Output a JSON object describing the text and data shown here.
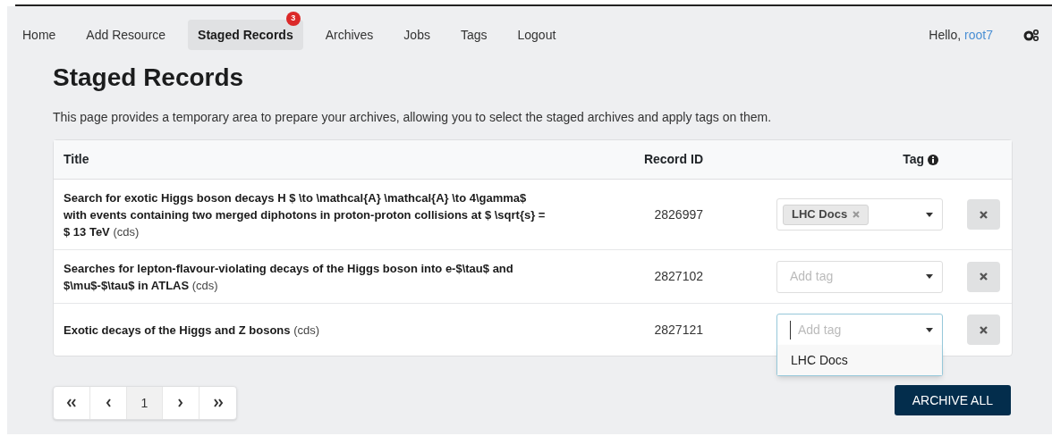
{
  "nav": {
    "items": [
      {
        "label": "Home",
        "selected": false
      },
      {
        "label": "Add Resource",
        "selected": false
      },
      {
        "label": "Staged Records",
        "selected": true,
        "badge": "3"
      },
      {
        "label": "Archives",
        "selected": false
      },
      {
        "label": "Jobs",
        "selected": false
      },
      {
        "label": "Tags",
        "selected": false
      },
      {
        "label": "Logout",
        "selected": false
      }
    ],
    "greeting": "Hello,",
    "user": "root7"
  },
  "heading": "Staged Records",
  "description": "This page provides a temporary area to prepare your archives, allowing you to select the staged archives and apply tags on them.",
  "table": {
    "columns": [
      "Title",
      "Record ID",
      "Tag"
    ],
    "rows": [
      {
        "title": "**Search for exotic Higgs boson decays H $ \\to \\mathcal{A} \\mathcal{A} \\to 4\\gamma$ with events containing two merged diphotons in proton-proton collisions at $ \\sqrt{s} = $ 13 TeV** (cds)",
        "record_id": "2826997",
        "tags": [
          "LHC Docs"
        ],
        "focused": false
      },
      {
        "title": "**Searches for lepton-flavour-violating decays of the Higgs boson into e-$\\tau$ and $\\mu$-$\\tau$ in ATLAS** (cds)",
        "record_id": "2827102",
        "placeholder": "Add tag",
        "focused": false
      },
      {
        "title": "**Exotic decays of the Higgs and Z bosons** (cds)",
        "record_id": "2827121",
        "placeholder": "Add tag",
        "focused": true,
        "options": [
          "LHC Docs"
        ]
      }
    ]
  },
  "pagination": {
    "pages": [
      {
        "label": "1",
        "selected": true
      }
    ]
  },
  "archive_button": "ARCHIVE ALL"
}
